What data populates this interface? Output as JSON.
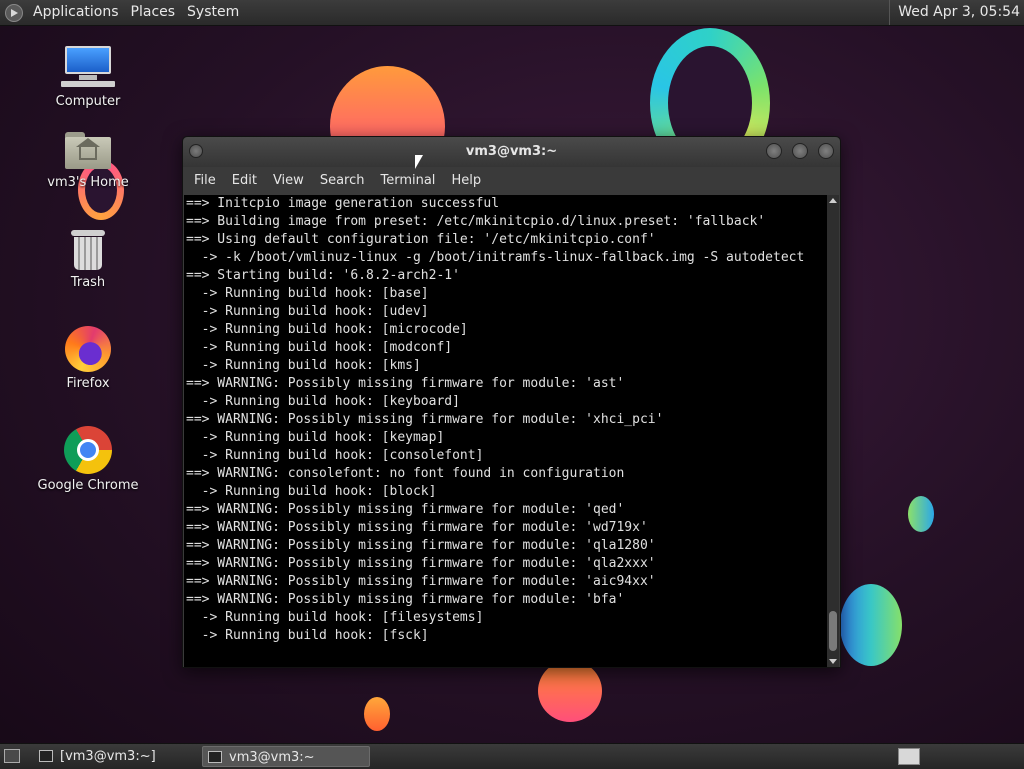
{
  "top_panel": {
    "menus": [
      "Applications",
      "Places",
      "System"
    ],
    "clock": "Wed Apr 3, 05:54"
  },
  "desktop": {
    "icons": [
      {
        "label": "Computer",
        "icon": "computer-icon"
      },
      {
        "label": "vm3's Home",
        "icon": "home-folder-icon"
      },
      {
        "label": "Trash",
        "icon": "trash-icon"
      },
      {
        "label": "Firefox",
        "icon": "firefox-icon"
      },
      {
        "label": "Google Chrome",
        "icon": "chrome-icon"
      }
    ]
  },
  "terminal": {
    "title": "vm3@vm3:~",
    "menu": [
      "File",
      "Edit",
      "View",
      "Search",
      "Terminal",
      "Help"
    ],
    "lines": [
      "==> Initcpio image generation successful",
      "==> Building image from preset: /etc/mkinitcpio.d/linux.preset: 'fallback'",
      "==> Using default configuration file: '/etc/mkinitcpio.conf'",
      "  -> -k /boot/vmlinuz-linux -g /boot/initramfs-linux-fallback.img -S autodetect",
      "==> Starting build: '6.8.2-arch2-1'",
      "  -> Running build hook: [base]",
      "  -> Running build hook: [udev]",
      "  -> Running build hook: [microcode]",
      "  -> Running build hook: [modconf]",
      "  -> Running build hook: [kms]",
      "==> WARNING: Possibly missing firmware for module: 'ast'",
      "  -> Running build hook: [keyboard]",
      "==> WARNING: Possibly missing firmware for module: 'xhci_pci'",
      "  -> Running build hook: [keymap]",
      "  -> Running build hook: [consolefont]",
      "==> WARNING: consolefont: no font found in configuration",
      "  -> Running build hook: [block]",
      "==> WARNING: Possibly missing firmware for module: 'qed'",
      "==> WARNING: Possibly missing firmware for module: 'wd719x'",
      "==> WARNING: Possibly missing firmware for module: 'qla1280'",
      "==> WARNING: Possibly missing firmware for module: 'qla2xxx'",
      "==> WARNING: Possibly missing firmware for module: 'aic94xx'",
      "==> WARNING: Possibly missing firmware for module: 'bfa'",
      "  -> Running build hook: [filesystems]",
      "  -> Running build hook: [fsck]"
    ]
  },
  "bottom_panel": {
    "tasks": [
      "[vm3@vm3:~]",
      "vm3@vm3:~"
    ]
  }
}
